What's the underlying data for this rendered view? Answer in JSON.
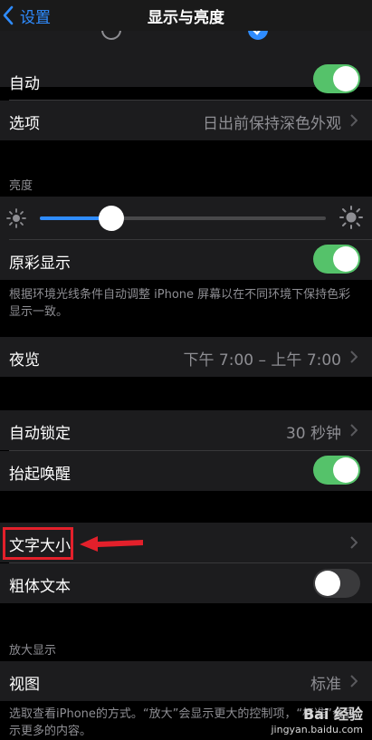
{
  "nav": {
    "back_label": "设置",
    "title": "显示与亮度"
  },
  "appearance": {
    "auto_label": "自动",
    "auto_on": true,
    "options_label": "选项",
    "options_value": "日出前保持深色外观"
  },
  "brightness": {
    "header": "亮度",
    "level": 0.25,
    "true_tone_label": "原彩显示",
    "true_tone_on": true,
    "footer": "根据环境光线条件自动调整 iPhone 屏幕以在不同环境下保持色彩显示一致。"
  },
  "night_shift": {
    "label": "夜览",
    "value": "下午 7:00 – 上午 7:00"
  },
  "lock": {
    "auto_lock_label": "自动锁定",
    "auto_lock_value": "30 秒钟",
    "raise_to_wake_label": "抬起唤醒",
    "raise_to_wake_on": true
  },
  "text": {
    "text_size_label": "文字大小",
    "bold_text_label": "粗体文本",
    "bold_text_on": false
  },
  "zoom": {
    "header": "放大显示",
    "view_label": "视图",
    "view_value": "标准",
    "footer": "选取查看iPhone的方式。“放大”会显示更大的控制项，“标准”会显示更多的内容。"
  },
  "watermark": {
    "line1": "Bai 经验",
    "line2": "jingyan.baidu.com"
  },
  "colors": {
    "accent": "#2f8cff",
    "toggle_on": "#55c26a",
    "highlight": "#e3202b"
  },
  "icons": [
    "chevron-left-icon",
    "chevron-right-icon",
    "sun-small-icon",
    "sun-large-icon",
    "red-arrow-icon"
  ]
}
